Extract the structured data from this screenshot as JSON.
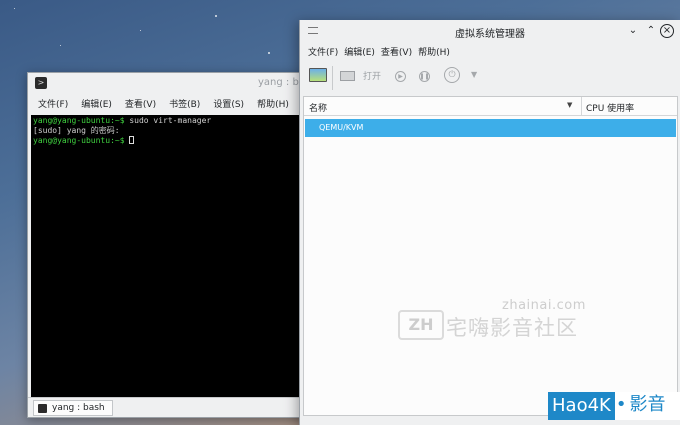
{
  "terminal": {
    "title": "yang : bash",
    "menu": [
      "文件(F)",
      "编辑(E)",
      "查看(V)",
      "书签(B)",
      "设置(S)",
      "帮助(H)"
    ],
    "lines": [
      {
        "prompt": "yang@yang-ubuntu:~$",
        "text": " sudo virt-manager"
      },
      {
        "prompt": "",
        "text": "[sudo] yang 的密码:"
      },
      {
        "prompt": "yang@yang-ubuntu:~$",
        "text": " "
      }
    ],
    "tab_label": "yang : bash"
  },
  "virt_manager": {
    "title": "虚拟系统管理器",
    "menu": [
      "文件(F)",
      "编辑(E)",
      "查看(V)",
      "帮助(H)"
    ],
    "toolbar": {
      "open_label": "打开"
    },
    "columns": {
      "name": "名称",
      "cpu": "CPU 使用率"
    },
    "rows": [
      {
        "name": "QEMU/KVM"
      }
    ]
  },
  "watermark": {
    "url": "zhainai.com",
    "logo": "ZH",
    "text": "宅嗨影音社区"
  },
  "badge": {
    "brand": "Hao4K",
    "suffix": "影音"
  }
}
